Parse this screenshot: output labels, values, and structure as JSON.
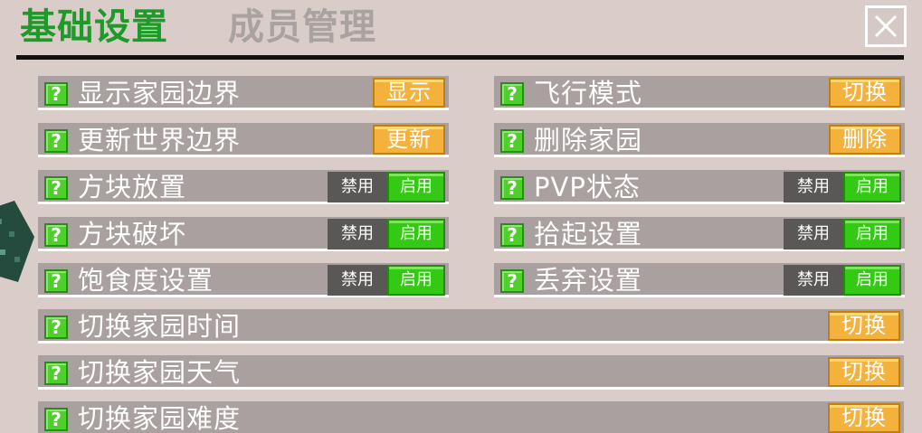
{
  "tabs": [
    {
      "label": "基础设置",
      "active": true
    },
    {
      "label": "成员管理",
      "active": false
    }
  ],
  "close_icon": "close-x-icon",
  "help_icon": {
    "glyph": "?",
    "name": "help-question-icon"
  },
  "left_rows": [
    {
      "label": "显示家园边界",
      "control": "button",
      "button_label": "显示"
    },
    {
      "label": "更新世界边界",
      "control": "button",
      "button_label": "更新"
    },
    {
      "label": "方块放置",
      "control": "toggle",
      "off_label": "禁用",
      "on_label": "启用"
    },
    {
      "label": "方块破坏",
      "control": "toggle",
      "off_label": "禁用",
      "on_label": "启用"
    },
    {
      "label": "饱食度设置",
      "control": "toggle",
      "off_label": "禁用",
      "on_label": "启用"
    }
  ],
  "right_rows": [
    {
      "label": "飞行模式",
      "control": "button",
      "button_label": "切换"
    },
    {
      "label": "删除家园",
      "control": "button",
      "button_label": "删除"
    },
    {
      "label": "PVP状态",
      "control": "toggle",
      "off_label": "禁用",
      "on_label": "启用"
    },
    {
      "label": "拾起设置",
      "control": "toggle",
      "off_label": "禁用",
      "on_label": "启用"
    },
    {
      "label": "丢弃设置",
      "control": "toggle",
      "off_label": "禁用",
      "on_label": "启用"
    }
  ],
  "full_rows": [
    {
      "label": "切换家园时间",
      "button_label": "切换"
    },
    {
      "label": "切换家园天气",
      "button_label": "切换"
    },
    {
      "label": "切换家园难度",
      "button_label": "切换"
    }
  ],
  "colors": {
    "background": "#dacdc9",
    "active_tab": "#1e9a28",
    "inactive_tab": "#a9a2a0",
    "row": "#aba0a0",
    "button_orange": "#f4b13b",
    "toggle_on": "#34c914",
    "toggle_off": "#5a5856"
  }
}
